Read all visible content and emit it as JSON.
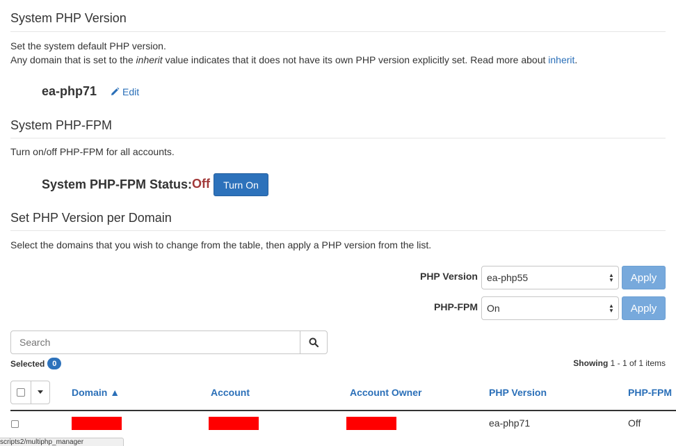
{
  "php_version_section": {
    "title": "System PHP Version",
    "desc_line1": "Set the system default PHP version.",
    "desc_line2_before": "Any domain that is set to the ",
    "desc_line2_em": "inherit",
    "desc_line2_after": " value indicates that it does not have its own PHP version explicitly set. Read more about ",
    "desc_line2_link": "inherit",
    "desc_line2_end": ".",
    "current_version": "ea-php71",
    "edit_label": "Edit"
  },
  "fpm_section": {
    "title": "System PHP-FPM",
    "desc": "Turn on/off PHP-FPM for all accounts.",
    "status_label": "System PHP-FPM Status:",
    "status_value": "Off",
    "status_color": "#a23a3a",
    "turn_on_label": "Turn On"
  },
  "per_domain_section": {
    "title": "Set PHP Version per Domain",
    "desc": "Select the domains that you wish to change from the table, then apply a PHP version from the list.",
    "php_version_label": "PHP Version",
    "php_version_selected": "ea-php55",
    "php_fpm_label": "PHP-FPM",
    "php_fpm_selected": "On",
    "apply_label": "Apply"
  },
  "table_controls": {
    "search_placeholder": "Search",
    "selected_label": "Selected",
    "selected_count": "0",
    "showing_label": "Showing",
    "showing_range": "1 - 1 of 1 items"
  },
  "table": {
    "columns": [
      "Domain ▲",
      "Account",
      "Account Owner",
      "PHP Version",
      "PHP-FPM"
    ],
    "rows": [
      {
        "domain": "",
        "account": "",
        "owner": "",
        "php_version": "ea-php71",
        "php_fpm": "Off"
      }
    ]
  },
  "status_bar": {
    "url": "scripts2/multiphp_manager"
  },
  "colors": {
    "accent": "#2d72bb",
    "link": "#2a6fb8",
    "redaction": "#ff0000"
  }
}
